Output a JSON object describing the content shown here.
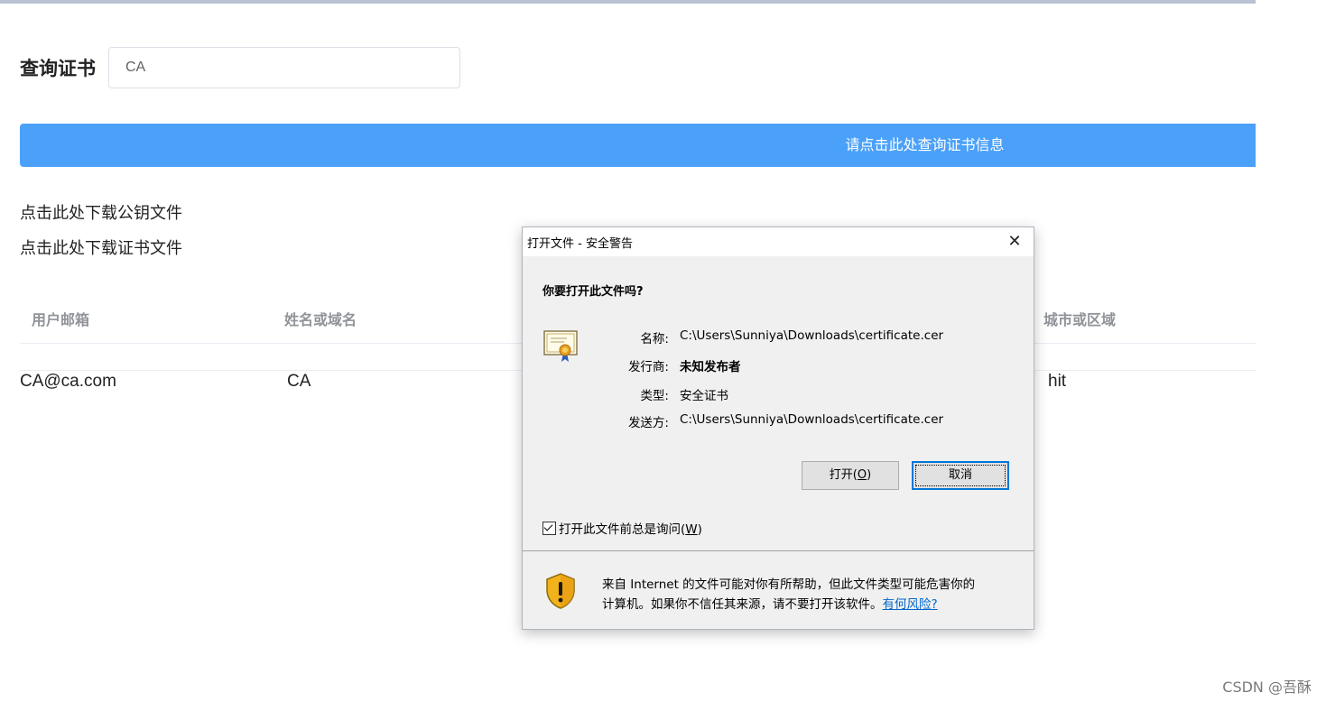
{
  "search": {
    "label": "查询证书",
    "value": "CA"
  },
  "query_button": {
    "label": "请点击此处查询证书信息"
  },
  "downloads": {
    "public_key": "点击此处下载公钥文件",
    "certificate": "点击此处下载证书文件"
  },
  "table": {
    "headers": {
      "email": "用户邮箱",
      "name": "姓名或域名",
      "city": "城市或区域"
    },
    "row": {
      "email": "CA@ca.com",
      "name": "CA",
      "city": "hit"
    }
  },
  "dialog": {
    "title": "打开文件 - 安全警告",
    "close_glyph": "✕",
    "question": "你要打开此文件吗?",
    "fields": [
      {
        "label": "名称:",
        "value": "C:\\Users\\Sunniya\\Downloads\\certificate.cer"
      },
      {
        "label": "发行商:",
        "value": "未知发布者"
      },
      {
        "label": "类型:",
        "value": "安全证书"
      },
      {
        "label": "发送方:",
        "value": "C:\\Users\\Sunniya\\Downloads\\certificate.cer"
      }
    ],
    "open_button": {
      "text": "打开(",
      "mnemonic": "O",
      "suffix": ")"
    },
    "cancel_button": "取消",
    "checkbox": {
      "text": "打开此文件前总是询问(",
      "mnemonic": "W",
      "suffix": ")",
      "checked": true
    },
    "warning": {
      "line1": "来自 Internet 的文件可能对你有所帮助，但此文件类型可能危害你的",
      "line2": "计算机。如果你不信任其来源，请不要打开该软件。",
      "link": "有何风险?"
    }
  },
  "watermark": "CSDN @吾酥",
  "colors": {
    "accent": "#4ba1f9",
    "link": "#0066cc",
    "dialog_bg": "#f0f0f0"
  },
  "icons": {
    "certificate": "certificate-icon",
    "shield": "shield-warning-icon",
    "close": "close-icon"
  }
}
